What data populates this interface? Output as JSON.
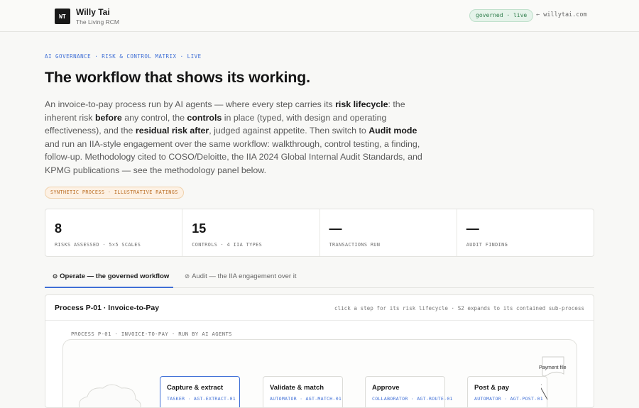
{
  "header": {
    "logo_text": "WT",
    "brand_name": "Willy Tai",
    "brand_sub": "The Living RCM",
    "status_badge": "governed · live",
    "back_link": "← willytai.com"
  },
  "hero": {
    "eyebrow": "AI GOVERNANCE · RISK & CONTROL MATRIX · LIVE",
    "title": "The workflow that shows its working.",
    "intro": [
      {
        "t": "An invoice-to-pay process run by AI agents — where every step carries its ",
        "b": false
      },
      {
        "t": "risk lifecycle",
        "b": true
      },
      {
        "t": ": the inherent risk ",
        "b": false
      },
      {
        "t": "before",
        "b": true
      },
      {
        "t": " any control, the ",
        "b": false
      },
      {
        "t": "controls",
        "b": true
      },
      {
        "t": " in place (typed, with design and operating effectiveness), and the ",
        "b": false
      },
      {
        "t": "residual risk after",
        "b": true
      },
      {
        "t": ", judged against appetite. Then switch to ",
        "b": false
      },
      {
        "t": "Audit mode",
        "b": true
      },
      {
        "t": " and run an IIA-style engagement over the same workflow: walkthrough, control testing, a finding, follow-up. Methodology cited to COSO/Deloitte, the IIA 2024 Global Internal Audit Standards, and KPMG publications — see the methodology panel below.",
        "b": false
      }
    ],
    "synthetic_badge": "SYNTHETIC PROCESS · ILLUSTRATIVE RATINGS"
  },
  "stats": [
    {
      "value": "8",
      "label": "RISKS ASSESSED · 5×5 SCALES"
    },
    {
      "value": "15",
      "label": "CONTROLS · 4 IIA TYPES"
    },
    {
      "value": "—",
      "label": "TRANSACTIONS RUN"
    },
    {
      "value": "—",
      "label": "AUDIT FINDING"
    }
  ],
  "tabs": {
    "operate": {
      "glyph": "⊙",
      "label": "Operate — the governed workflow"
    },
    "audit": {
      "glyph": "⊘",
      "label": "Audit — the IIA engagement over it"
    }
  },
  "panel": {
    "title": "Process P-01 · Invoice-to-Pay",
    "hint": "click a step for its risk lifecycle · S2 expands to its contained sub-process",
    "process_label": "PROCESS P-01 · INVOICE-TO-PAY · RUN BY AI AGENTS",
    "steps": [
      {
        "title": "Capture & extract",
        "meta": "TASKER · AGT-EXTRACT-01"
      },
      {
        "title": "Validate & match",
        "meta": "AUTOMATOR · AGT-MATCH-01"
      },
      {
        "title": "Approve",
        "meta": "COLLABORATOR · AGT-ROUTE-01"
      },
      {
        "title": "Post & pay",
        "meta": "AUTOMATOR · AGT-POST-01"
      }
    ],
    "output_label": "Payment file"
  },
  "colors": {
    "accent": "#3f6fd6",
    "governed": "#2e7d4b",
    "synthetic": "#b96a1f"
  }
}
